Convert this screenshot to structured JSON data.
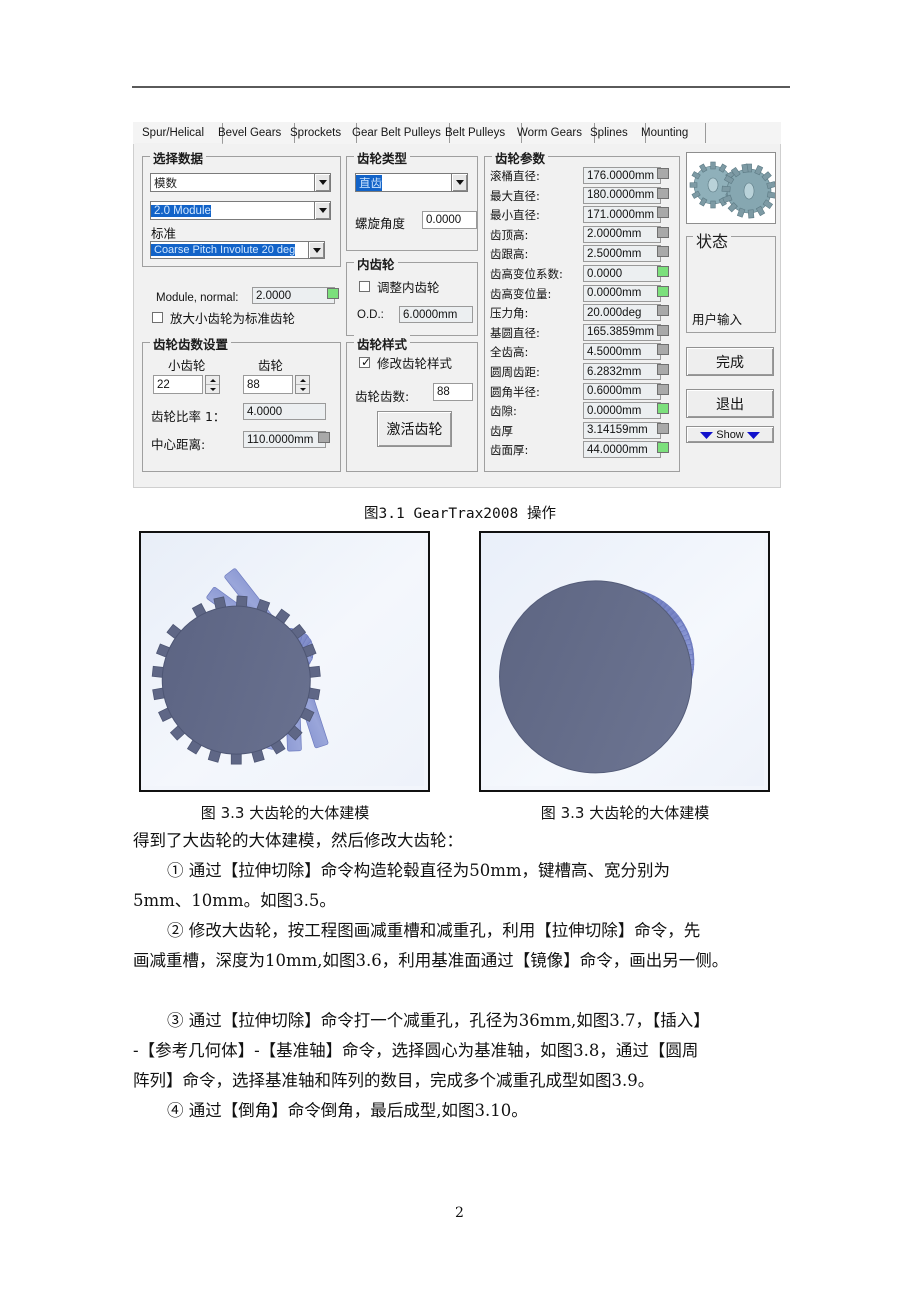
{
  "document": {
    "page_number": "2",
    "figure_caption_main": "图3.1 GearTrax2008 操作",
    "figure_caption_left": "图 3.3 大齿轮的大体建模",
    "figure_caption_right": "图 3.3 大齿轮的大体建模",
    "paragraphs": [
      "得到了大齿轮的大体建模，然后修改大齿轮：",
      "① 通过【拉伸切除】命令构造轮毂直径为50mm，键槽高、宽分别为",
      "5mm、10mm。如图3.5。",
      "② 修改大齿轮，按工程图画减重槽和减重孔，利用【拉伸切除】命令，先",
      "画减重槽，深度为10mm,如图3.6，利用基准面通过【镜像】命令，画出另一侧。",
      "③ 通过【拉伸切除】命令打一个减重孔，孔径为36mm,如图3.7，【插入】",
      "-【参考几何体】-【基准轴】命令，选择圆心为基准轴，如图3.8，通过【圆周",
      "阵列】命令，选择基准轴和阵列的数目，完成多个减重孔成型如图3.9。",
      "④ 通过【倒角】命令倒角，最后成型,如图3.10。"
    ]
  },
  "dialog": {
    "tabs": [
      {
        "label": "Spur/Helical",
        "selected": true
      },
      {
        "label": "Bevel Gears",
        "selected": false
      },
      {
        "label": "Sprockets",
        "selected": false
      },
      {
        "label": "Gear Belt Pulleys",
        "selected": false
      },
      {
        "label": "Belt Pulleys",
        "selected": false
      },
      {
        "label": "Worm Gears",
        "selected": false
      },
      {
        "label": "Splines",
        "selected": false
      },
      {
        "label": "Mounting",
        "selected": false
      }
    ],
    "select_data": {
      "title": "选择数据",
      "type_combo_value": "模数",
      "module_combo_value": "2.0 Module",
      "standard_label": "标准",
      "standard_combo_value": "Coarse Pitch Involute 20 deg",
      "module_normal_label": "Module, normal:",
      "module_normal_value": "2.0000",
      "enlarge_checkbox_label": "放大小齿轮为标准齿轮",
      "enlarge_checked": false
    },
    "teeth_count": {
      "title": "齿轮齿数设置",
      "pinion_label": "小齿轮",
      "pinion_value": "22",
      "gear_label": "齿轮",
      "gear_value": "88",
      "ratio_label": "齿轮比率 1：",
      "ratio_value": "4.0000",
      "center_distance_label": "中心距离:",
      "center_distance_value": "110.0000mm"
    },
    "gear_type": {
      "title": "齿轮类型",
      "combo_value": "直齿",
      "helix_label": "螺旋角度",
      "helix_value": "0.0000"
    },
    "internal_gear": {
      "title": "内齿轮",
      "adjust_checkbox_label": "调整内齿轮",
      "adjust_checked": false,
      "od_label": "O.D.:",
      "od_value": "6.0000mm"
    },
    "gear_style": {
      "title": "齿轮样式",
      "modify_checkbox_label": "修改齿轮样式",
      "modify_checked": true,
      "teeth_label": "齿轮齿数:",
      "teeth_value": "88",
      "activate_button": "激活齿轮"
    },
    "gear_params": {
      "title": "齿轮参数",
      "rows": [
        {
          "label": "滚桶直径:",
          "value": "176.0000mm",
          "swatch": "grey"
        },
        {
          "label": "最大直径:",
          "value": "180.0000mm",
          "swatch": "grey"
        },
        {
          "label": "最小直径:",
          "value": "171.0000mm",
          "swatch": "grey"
        },
        {
          "label": "齿顶高:",
          "value": "2.0000mm",
          "swatch": "grey"
        },
        {
          "label": "齿跟高:",
          "value": "2.5000mm",
          "swatch": "grey"
        },
        {
          "label": "齿高变位系数:",
          "value": "0.0000",
          "swatch": "green"
        },
        {
          "label": "齿高变位量:",
          "value": "0.0000mm",
          "swatch": "green"
        },
        {
          "label": "压力角:",
          "value": "20.000deg",
          "swatch": "grey"
        },
        {
          "label": "基圆直径:",
          "value": "165.3859mm",
          "swatch": "grey"
        },
        {
          "label": "全齿高:",
          "value": "4.5000mm",
          "swatch": "grey"
        },
        {
          "label": "圆周齿距:",
          "value": "6.2832mm",
          "swatch": "grey"
        },
        {
          "label": "圆角半径:",
          "value": "0.6000mm",
          "swatch": "grey"
        },
        {
          "label": "齿隙:",
          "value": "0.0000mm",
          "swatch": "green"
        },
        {
          "label": "齿厚",
          "value": "3.14159mm",
          "swatch": "grey"
        },
        {
          "label": "齿面厚:",
          "value": "44.0000mm",
          "swatch": "green"
        }
      ]
    },
    "right_panel": {
      "status_title": "状态",
      "status_text": "用户输入",
      "finish_button": "完成",
      "exit_button": "退出",
      "show_button": "Show"
    },
    "colors": {
      "dialog_bg": "#f1f1f1",
      "highlight": "#1263c8",
      "swatch_green": "#7ce07c",
      "swatch_grey": "#a9a9a9",
      "gear_blue": "#6b77b8",
      "show_arrow": "#1111cc"
    }
  }
}
